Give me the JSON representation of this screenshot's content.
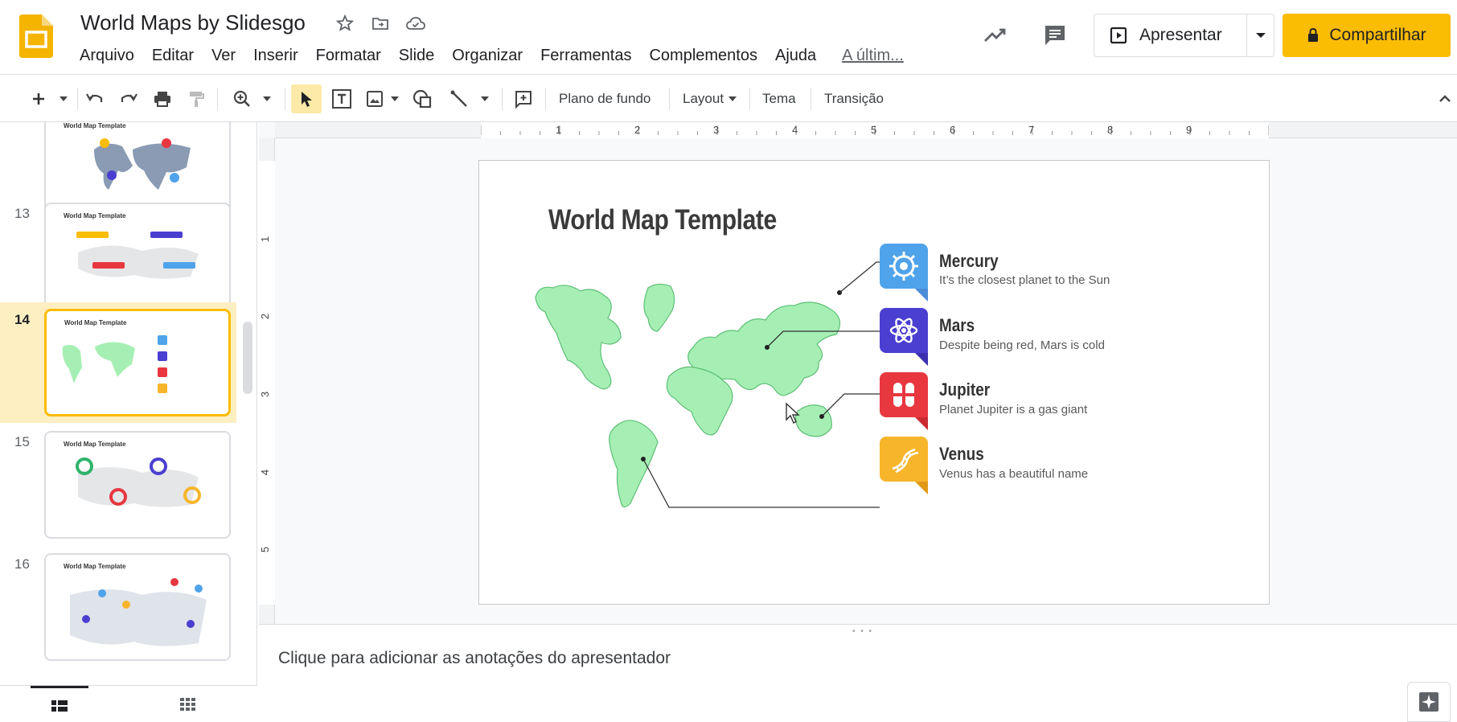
{
  "header": {
    "doc_title": "World Maps by Slidesgo",
    "menu": [
      "Arquivo",
      "Editar",
      "Ver",
      "Inserir",
      "Formatar",
      "Slide",
      "Organizar",
      "Ferramentas",
      "Complementos",
      "Ajuda"
    ],
    "last_edit": "A últim...",
    "present_label": "Apresentar",
    "share_label": "Compartilhar"
  },
  "toolbar": {
    "background": "Plano de fundo",
    "layout": "Layout",
    "theme": "Tema",
    "transition": "Transição"
  },
  "ruler": {
    "top": [
      "1",
      "2",
      "3",
      "4",
      "5",
      "6",
      "7",
      "8",
      "9"
    ],
    "left": [
      "1",
      "2",
      "3",
      "4",
      "5"
    ]
  },
  "filmstrip": {
    "slides": [
      {
        "num": "",
        "title": "World Map Template"
      },
      {
        "num": "13",
        "title": "World Map Template"
      },
      {
        "num": "14",
        "title": "World Map Template"
      },
      {
        "num": "15",
        "title": "World Map Template"
      },
      {
        "num": "16",
        "title": "World Map Template"
      }
    ]
  },
  "slide": {
    "title": "World Map Template",
    "planets": [
      {
        "name": "Mercury",
        "desc": "It’s the closest planet to the Sun",
        "color": "#4fa3ea",
        "icon": "gear-icon"
      },
      {
        "name": "Mars",
        "desc": "Despite being red, Mars is cold",
        "color": "#4a3fd0",
        "icon": "atom-icon"
      },
      {
        "name": "Jupiter",
        "desc": "Planet Jupiter is a gas giant",
        "color": "#e8373f",
        "icon": "pill-icon"
      },
      {
        "name": "Venus",
        "desc": "Venus has a beautiful name",
        "color": "#f7b52b",
        "icon": "dna-icon"
      }
    ]
  },
  "notes": {
    "placeholder": "Clique para adicionar as anotações do apresentador"
  },
  "colors": {
    "accent": "#fbbc04",
    "map_fill": "#a6efb4",
    "map_stroke": "#5cbf75"
  }
}
